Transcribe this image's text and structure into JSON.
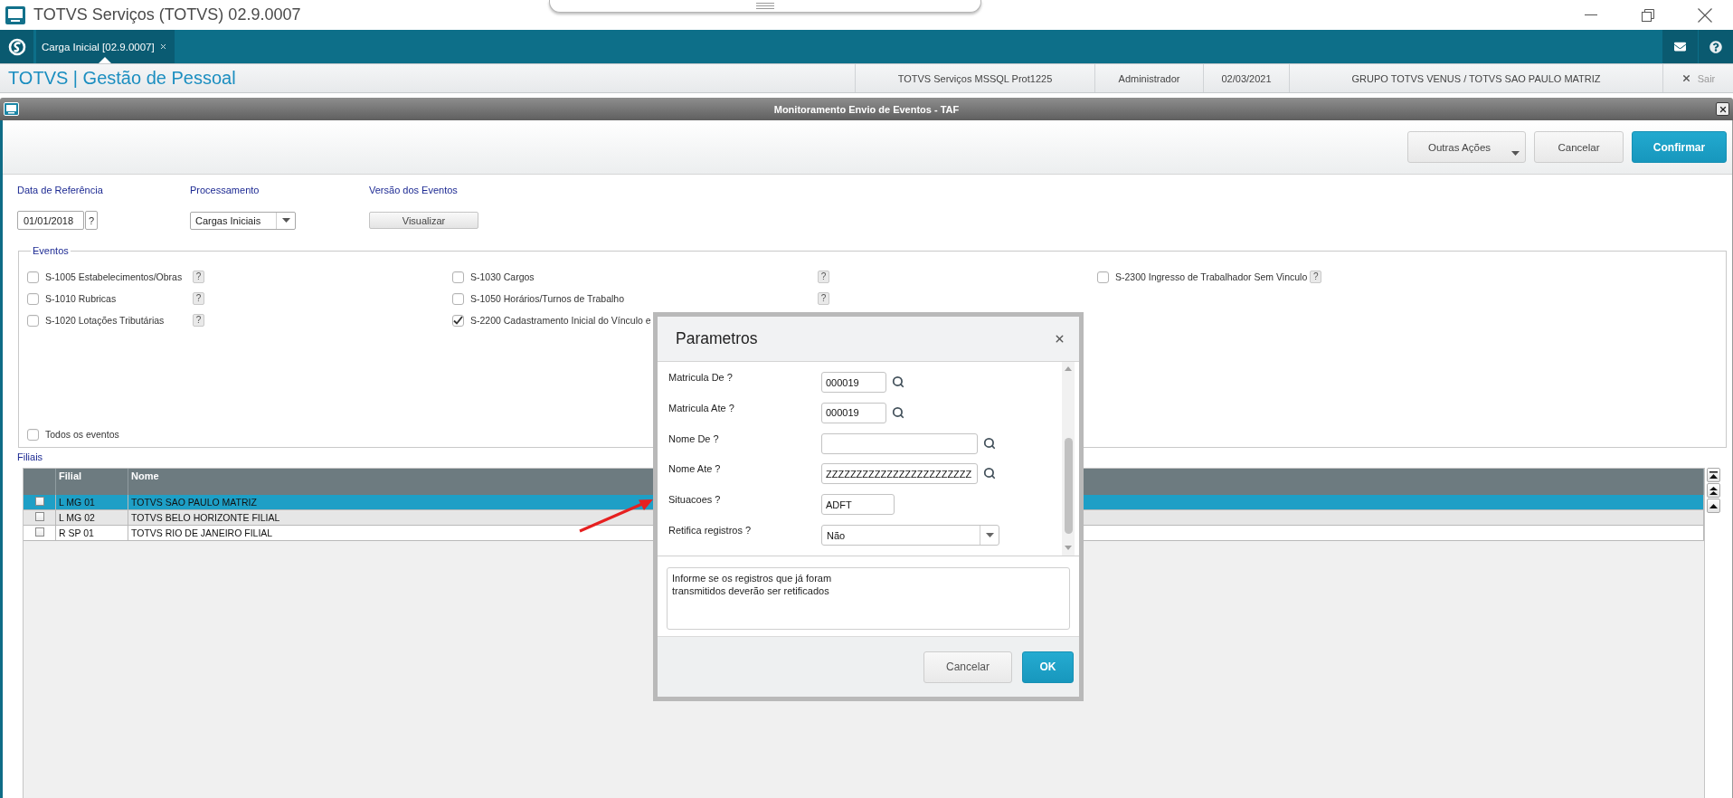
{
  "app_window": {
    "title": "TOTVS Serviços (TOTVS) 02.9.0007"
  },
  "tab_bar": {
    "tabs": [
      {
        "label": "Carga Inicial [02.9.0007]",
        "selected": true
      }
    ]
  },
  "header": {
    "title": "TOTVS | Gestão de Pessoal",
    "info": [
      "TOTVS Serviços MSSQL Prot1225",
      "Administrador",
      "02/03/2021",
      "GRUPO TOTVS VENUS / TOTVS SAO PAULO MATRIZ"
    ],
    "exit_label": "Sair"
  },
  "window": {
    "title": "Monitoramento Envio de Eventos - TAF",
    "actions": [
      {
        "label": "Outras Ações",
        "kind": "menu"
      },
      {
        "label": "Cancelar",
        "kind": "secondary"
      },
      {
        "label": "Confirmar",
        "kind": "primary"
      }
    ],
    "filters": [
      {
        "label": "Data de Referência",
        "kind": "date",
        "value": "01/01/2018",
        "help": "?"
      },
      {
        "label": "Processamento",
        "kind": "select",
        "value": "Cargas Iniciais"
      },
      {
        "label": "Versão dos Eventos",
        "kind": "button",
        "value": "Visualizar"
      }
    ],
    "events": {
      "title": "Eventos",
      "columns": [
        {
          "items": [
            {
              "label": "S-1005 Estabelecimentos/Obras",
              "checked": false,
              "help": "?"
            },
            {
              "label": "S-1010 Rubricas",
              "checked": false,
              "help": "?"
            },
            {
              "label": "S-1020 Lotações Tributárias",
              "checked": false,
              "help": "?"
            }
          ]
        },
        {
          "items": [
            {
              "label": "S-1030 Cargos",
              "checked": false,
              "help": "?"
            },
            {
              "label": "S-1050 Horários/Turnos de Trabalho",
              "checked": false,
              "help": "?"
            },
            {
              "label": "S-2200 Cadastramento Inicial do Vínculo e",
              "checked": true
            }
          ]
        },
        {
          "items": [
            {
              "label": "S-2300 Ingresso de Trabalhador Sem Vinculo",
              "checked": false,
              "help": "?"
            }
          ]
        }
      ],
      "select_all": {
        "label": "Todos os eventos",
        "checked": false
      }
    },
    "branches": {
      "title": "Filiais",
      "columns": [
        "Filial",
        "Nome"
      ],
      "rows": [
        {
          "selected": true,
          "checked": false,
          "cells": [
            "L MG 01",
            "TOTVS SAO PAULO MATRIZ"
          ]
        },
        {
          "selected": false,
          "checked": false,
          "cells": [
            "L MG 02",
            "TOTVS BELO HORIZONTE FILIAL"
          ]
        },
        {
          "selected": false,
          "checked": false,
          "cells": [
            "R SP 01",
            "TOTVS RIO DE JANEIRO FILIAL"
          ]
        }
      ]
    }
  },
  "dialog": {
    "title": "Parametros",
    "fields": [
      {
        "label": "Matricula De ?",
        "kind": "code",
        "value": "000019"
      },
      {
        "label": "Matricula Ate ?",
        "kind": "code",
        "value": "000019"
      },
      {
        "label": "Nome De ?",
        "kind": "name"
      },
      {
        "label": "Nome Ate ?",
        "kind": "name",
        "value": "ZZZZZZZZZZZZZZZZZZZZZZZZ"
      },
      {
        "label": "Situacoes ?",
        "kind": "text",
        "value": "ADFT"
      },
      {
        "label": "Retifica registros ?",
        "kind": "select",
        "value": "Não"
      }
    ],
    "help_text": "Informe se os registros que já foram\ntransmitidos deverão ser retificados",
    "buttons": [
      {
        "label": "Cancelar",
        "kind": "secondary"
      },
      {
        "label": "OK",
        "kind": "primary"
      }
    ]
  }
}
